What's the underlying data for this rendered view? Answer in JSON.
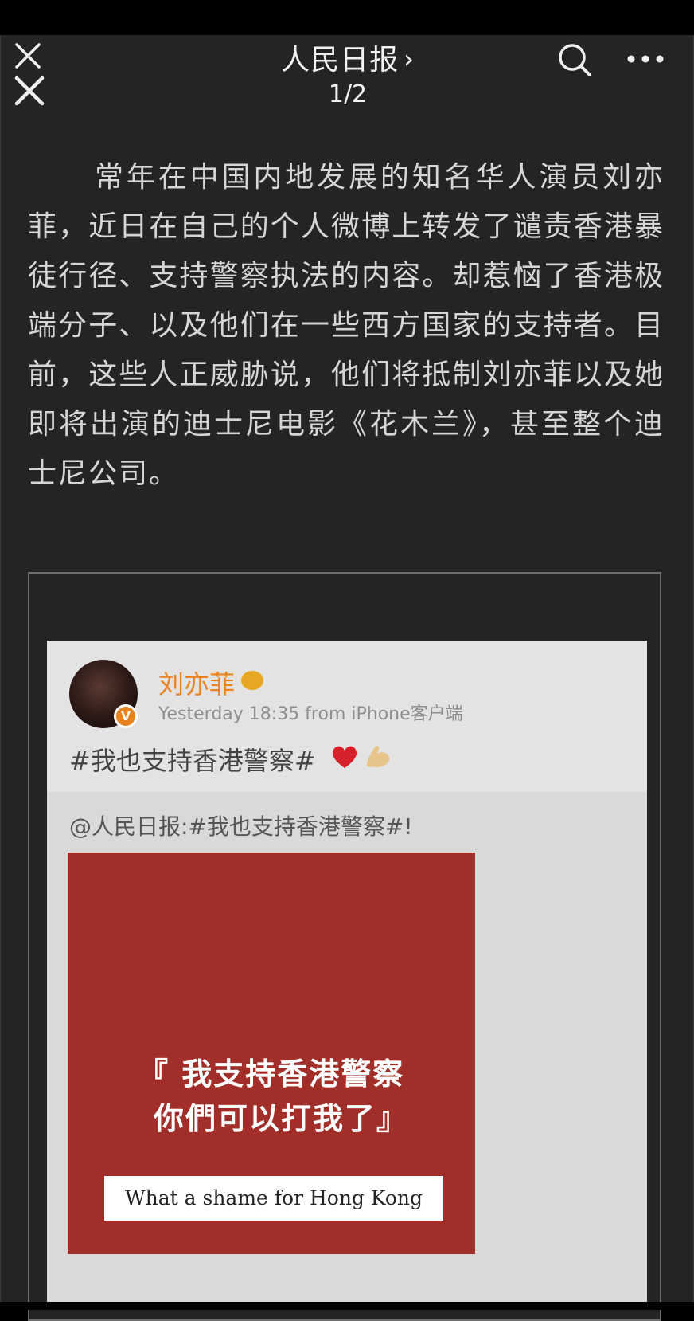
{
  "header": {
    "account_name": "人民日报",
    "account_chevron": "›",
    "page_counter": "1/2",
    "icons": [
      "close-icon",
      "close-icon",
      "search-icon",
      "more-icon"
    ]
  },
  "article": {
    "paragraph": "常年在中国内地发展的知名华人演员刘亦菲，近日在自己的个人微博上转发了谴责香港暴徒行径、支持警察执法的内容。却惹恼了香港极端分子、以及他们在一些西方国家的支持者。目前，这些人正威胁说，他们将抵制刘亦菲以及她即将出演的迪士尼电影《花木兰》，甚至整个迪士尼公司。"
  },
  "weibo_post": {
    "user_name": "刘亦菲",
    "verified_badge": "V",
    "meta": "Yesterday 18:35  from iPhone客户端",
    "text": "#我也支持香港警察#",
    "emoji": [
      "heart-icon",
      "muscle-icon"
    ],
    "repost_text": "@人民日报:#我也支持香港警察#!",
    "poster": {
      "line1": "『 我支持香港警察",
      "line2": "你們可以打我了』",
      "caption": "What a shame for Hong Kong"
    }
  },
  "colors": {
    "background": "#242424",
    "weibo_orange": "#e8831f",
    "poster_red": "#a12e28"
  }
}
